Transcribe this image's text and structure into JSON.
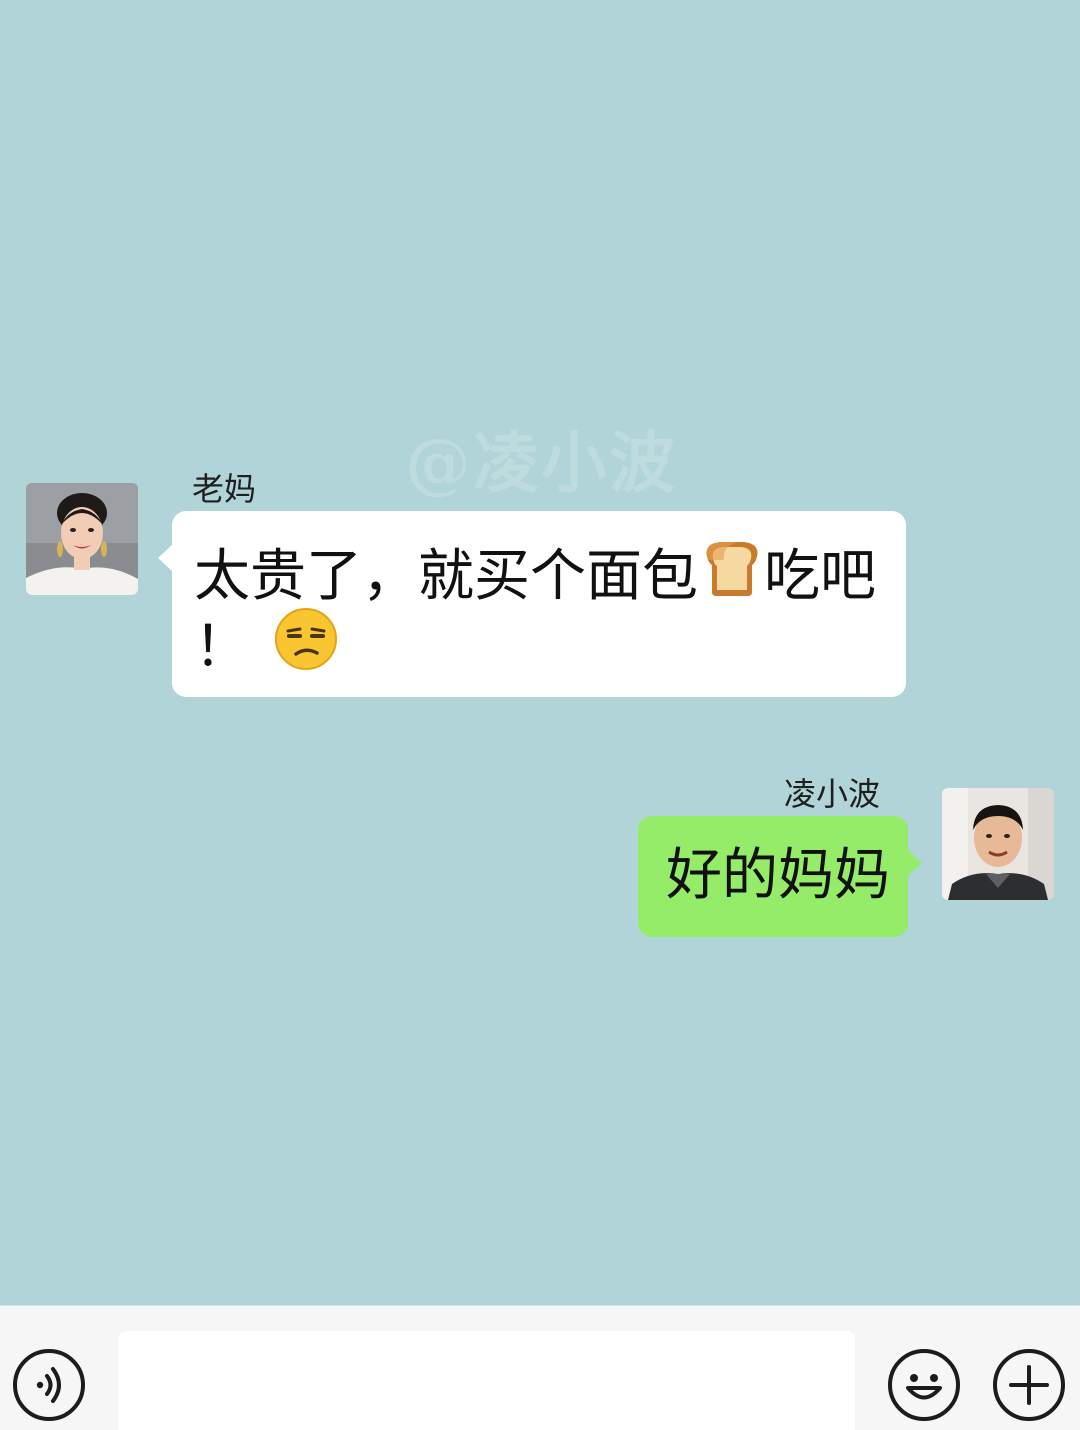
{
  "watermark": "@凌小波",
  "messages": [
    {
      "sender": "老妈",
      "side": "left",
      "line1": "太贵了，就买个面包",
      "line1_suffix": "吃吧",
      "line2": "！",
      "emojis": [
        "bread-emoji",
        "unamused-face-emoji"
      ]
    },
    {
      "sender": "凌小波",
      "side": "right",
      "text": "好的妈妈"
    }
  ],
  "input_bar": {
    "placeholder": "",
    "icons": [
      "voice-icon",
      "emoji-icon",
      "add-icon"
    ]
  },
  "colors": {
    "background": "#b0d4d7",
    "bubble_received": "#ffffff",
    "bubble_sent": "#95ec69",
    "input_bar": "#f6f6f6"
  }
}
